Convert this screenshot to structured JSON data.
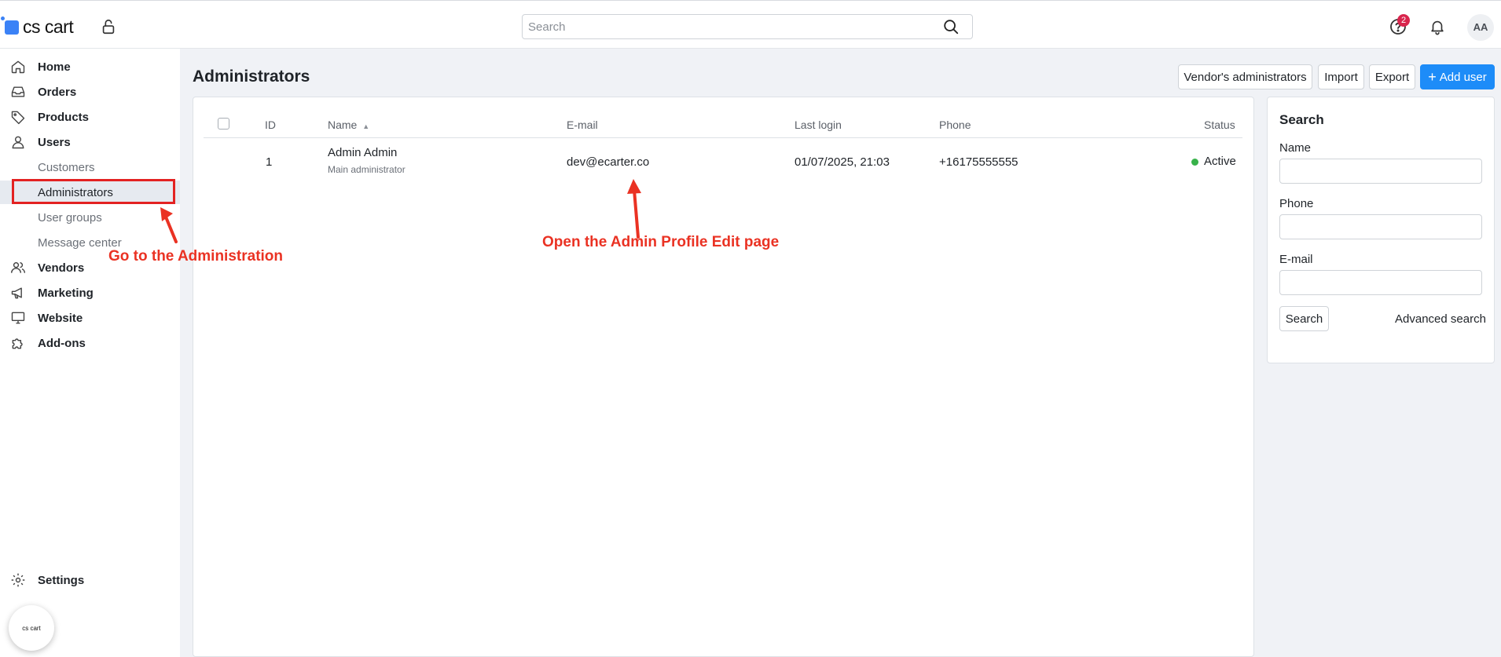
{
  "app": {
    "logo_text": "cs cart"
  },
  "topbar": {
    "search_placeholder": "Search",
    "help_badge_count": "2",
    "avatar_initials": "AA"
  },
  "sidebar": {
    "items": [
      {
        "label": "Home",
        "icon": "home-icon"
      },
      {
        "label": "Orders",
        "icon": "inbox-icon"
      },
      {
        "label": "Products",
        "icon": "tag-icon"
      },
      {
        "label": "Users",
        "icon": "user-icon"
      },
      {
        "label": "Vendors",
        "icon": "users-icon"
      },
      {
        "label": "Marketing",
        "icon": "megaphone-icon"
      },
      {
        "label": "Website",
        "icon": "monitor-icon"
      },
      {
        "label": "Add-ons",
        "icon": "puzzle-icon"
      }
    ],
    "users_subitems": [
      "Customers",
      "Administrators",
      "User groups",
      "Message center"
    ],
    "active_subitem": "Administrators",
    "settings_label": "Settings",
    "chat_widget_text": "cs cart"
  },
  "page": {
    "title": "Administrators",
    "buttons": {
      "vendors_admins": "Vendor's administrators",
      "import": "Import",
      "export": "Export",
      "add_user": "Add user"
    }
  },
  "table": {
    "columns": [
      "ID",
      "Name",
      "E-mail",
      "Last login",
      "Phone",
      "Status"
    ],
    "rows": [
      {
        "id": "1",
        "name": "Admin Admin",
        "role": "Main administrator",
        "email": "dev@ecarter.co",
        "last_login": "01/07/2025, 21:03",
        "phone": "+16175555555",
        "status": "Active"
      }
    ]
  },
  "search_panel": {
    "title": "Search",
    "name_label": "Name",
    "phone_label": "Phone",
    "email_label": "E-mail",
    "search_button": "Search",
    "advanced_link": "Advanced search"
  },
  "annotations": {
    "sidebar_hint": "Go to the Administration",
    "table_hint": "Open the Admin Profile Edit page",
    "color": "#ea3223"
  },
  "colors": {
    "primary": "#1d8cf8",
    "status_active": "#38b24a",
    "badge": "#d9254d",
    "highlight": "#e32222"
  }
}
